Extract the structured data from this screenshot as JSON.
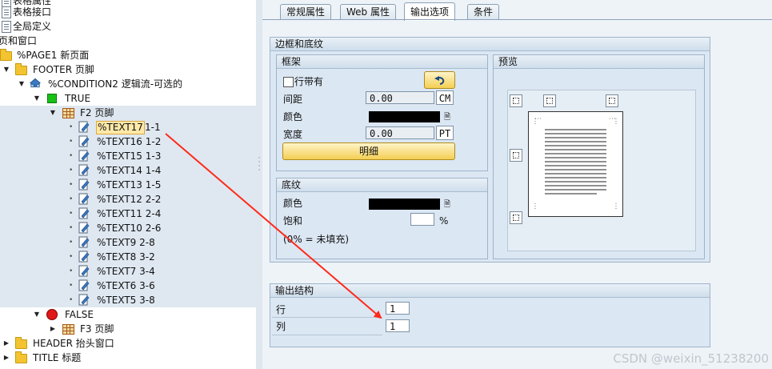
{
  "tree": {
    "items": [
      {
        "label": "表格属性",
        "indent": 0
      },
      {
        "label": "表格接口",
        "indent": 0
      },
      {
        "label": "全局定义",
        "indent": 0
      },
      {
        "label": "页和窗口",
        "indent": 0
      },
      {
        "label": "%PAGE1 新页面",
        "indent": 1
      },
      {
        "label": "FOOTER 页脚",
        "indent": 2
      },
      {
        "label": "%CONDITION2 逻辑流-可选的",
        "indent": 3
      },
      {
        "label": "TRUE",
        "indent": 4
      },
      {
        "label": "F2 页脚",
        "indent": 5
      },
      {
        "label": "%TEXT17",
        "suffix": "1-1",
        "selected": true
      },
      {
        "label": "%TEXT16 1-2"
      },
      {
        "label": "%TEXT15 1-3"
      },
      {
        "label": "%TEXT14 1-4"
      },
      {
        "label": "%TEXT13 1-5"
      },
      {
        "label": "%TEXT12 2-2"
      },
      {
        "label": "%TEXT11 2-4"
      },
      {
        "label": "%TEXT10 2-6"
      },
      {
        "label": "%TEXT9 2-8"
      },
      {
        "label": "%TEXT8 3-2"
      },
      {
        "label": "%TEXT7 3-4"
      },
      {
        "label": "%TEXT6 3-6"
      },
      {
        "label": "%TEXT5 3-8"
      },
      {
        "label": "FALSE"
      },
      {
        "label": "F3 页脚"
      },
      {
        "label": "HEADER 抬头窗口"
      },
      {
        "label": "TITLE 标题"
      }
    ]
  },
  "tabs": [
    {
      "label": "常规属性"
    },
    {
      "label": "Web 属性"
    },
    {
      "label": "输出选项",
      "active": true
    },
    {
      "label": "条件"
    }
  ],
  "border_group": {
    "title": "边框和底纹",
    "frame": {
      "title": "框架",
      "checkbox_label": "行带有",
      "checked": false,
      "spacing_label": "间距",
      "spacing_value": "0.00",
      "spacing_unit": "CM",
      "color_label": "颜色",
      "color_value": "#000000",
      "width_label": "宽度",
      "width_value": "0.00",
      "width_unit": "PT",
      "detail_button": "明细"
    },
    "shading": {
      "title": "底纹",
      "color_label": "颜色",
      "color_value": "#000000",
      "saturation_label": "饱和",
      "saturation_value": "",
      "saturation_unit": "%",
      "note": "(0% = 未填充)"
    },
    "preview": {
      "title": "预览"
    }
  },
  "output_group": {
    "title": "输出结构",
    "row_label": "行",
    "row_value": "1",
    "col_label": "列",
    "col_value": "1"
  },
  "watermark": "CSDN @weixin_51238200",
  "colors": {
    "arrow": "#ff2a1a",
    "selected_bg": "#ffe9a8"
  }
}
